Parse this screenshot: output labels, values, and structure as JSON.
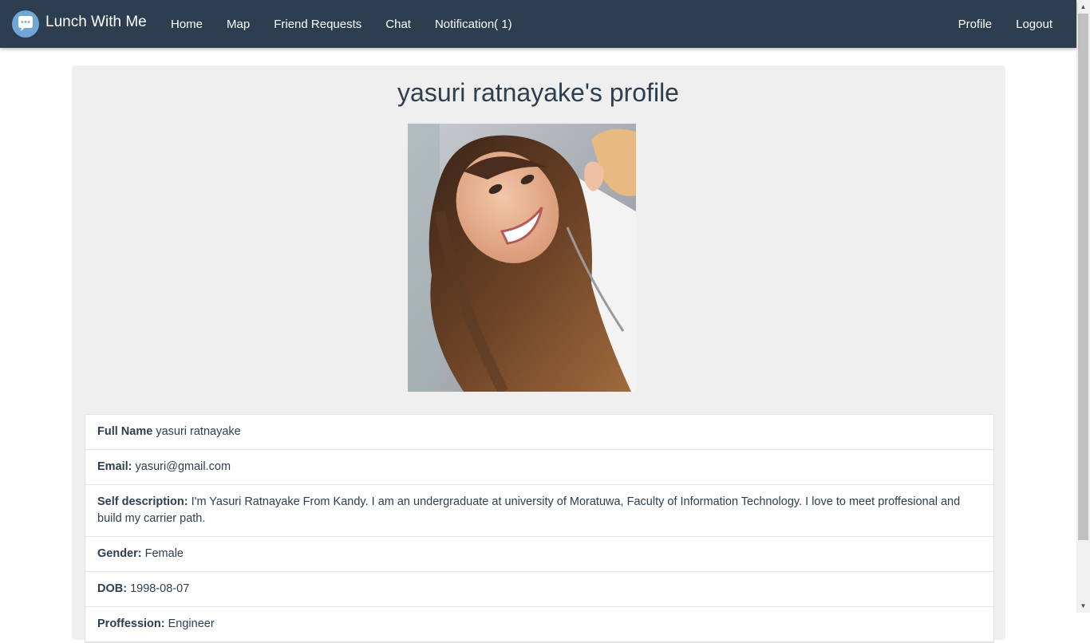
{
  "brand": {
    "name": "Lunch With Me",
    "logo_icon": "chat-bubble-icon"
  },
  "nav": {
    "left": [
      "Home",
      "Map",
      "Friend Requests",
      "Chat",
      "Notification( 1)"
    ],
    "right": [
      "Profile",
      "Logout"
    ]
  },
  "profile": {
    "title": "yasuri ratnayake's profile",
    "fields": [
      {
        "label": "Full Name",
        "value": "yasuri ratnayake"
      },
      {
        "label": "Email:",
        "value": "yasuri@gmail.com"
      },
      {
        "label": "Self description:",
        "value": "I'm Yasuri Ratnayake From Kandy. I am an undergraduate at university of Moratuwa, Faculty of Information Technology. I love to meet proffesional and build my carrier path."
      },
      {
        "label": "Gender:",
        "value": "Female"
      },
      {
        "label": "DOB:",
        "value": "1998-08-07"
      },
      {
        "label": "Proffession:",
        "value": "Engineer"
      }
    ]
  },
  "colors": {
    "navbar": "#2c3e50",
    "card": "#efefef",
    "text": "#2c3e50",
    "logo": "#6fa8d6"
  }
}
